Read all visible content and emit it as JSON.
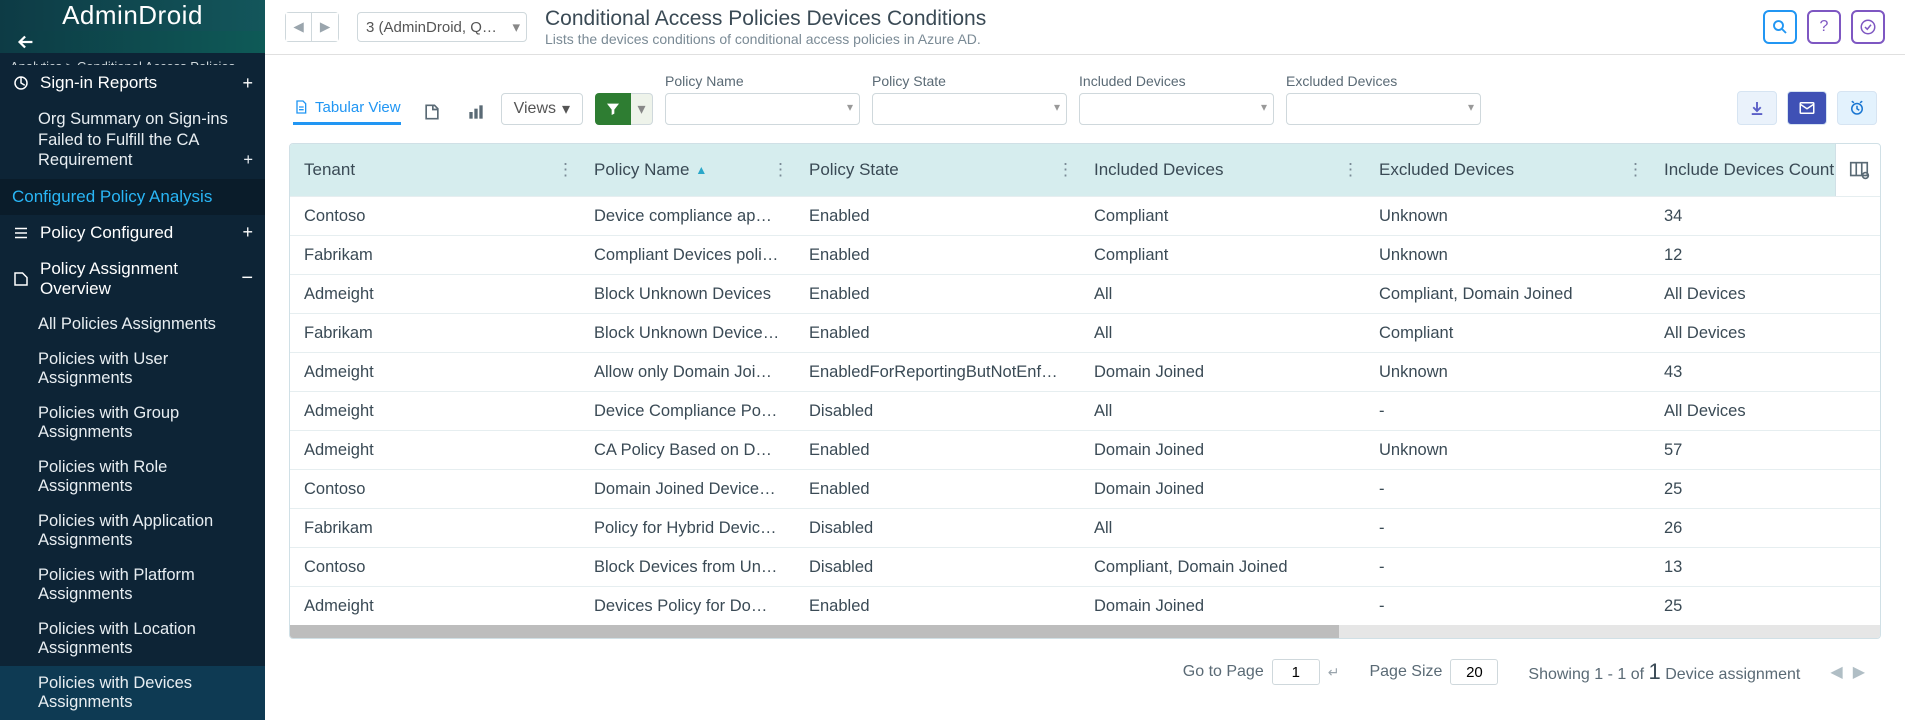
{
  "brand": "AdminDroid",
  "breadcrumb": "Analytics > Conditional Access Policies Ana…",
  "sidebar": {
    "signin": "Sign-in Reports",
    "org_summary": "Org Summary on Sign-ins Failed to Fulfill the CA Requirement",
    "config_analysis": "Configured Policy Analysis",
    "policy_configured": "Policy Configured",
    "assignment_overview": "Policy Assignment Overview",
    "subs": [
      "All Policies Assignments",
      "Policies with User Assignments",
      "Policies with Group Assignments",
      "Policies with Role Assignments",
      "Policies with Application Assignments",
      "Policies with Platform Assignments",
      "Policies with Location Assignments",
      "Policies with Devices Assignments"
    ]
  },
  "header": {
    "tenant_dd": "3 (AdminDroid, Q…",
    "title": "Conditional Access Policies Devices Conditions",
    "subtitle": "Lists the devices conditions of conditional access policies in Azure AD."
  },
  "toolbar": {
    "tabular": "Tabular View",
    "views": "Views",
    "filters": {
      "policy_name": "Policy Name",
      "policy_state": "Policy State",
      "included": "Included Devices",
      "excluded": "Excluded Devices"
    }
  },
  "columns": [
    "Tenant",
    "Policy Name",
    "Policy State",
    "Included Devices",
    "Excluded Devices",
    "Include Devices Count"
  ],
  "rows": [
    {
      "c": [
        "Contoso",
        "Device compliance app…",
        "Enabled",
        "Compliant",
        "Unknown",
        "34"
      ]
    },
    {
      "c": [
        "Fabrikam",
        "Compliant Devices poli…",
        "Enabled",
        "Compliant",
        "Unknown",
        "12"
      ]
    },
    {
      "c": [
        "Admeight",
        "Block Unknown Devices",
        "Enabled",
        "All",
        "Compliant, Domain Joined",
        "All Devices"
      ]
    },
    {
      "c": [
        "Fabrikam",
        "Block Unknown Device…",
        "Enabled",
        "All",
        "Compliant",
        "All Devices"
      ]
    },
    {
      "c": [
        "Admeight",
        "Allow only Domain Joi…",
        "EnabledForReportingButNotEnfor…",
        "Domain Joined",
        "Unknown",
        "43"
      ]
    },
    {
      "c": [
        "Admeight",
        "Device Compliance Pol…",
        "Disabled",
        "All",
        "-",
        "All Devices"
      ]
    },
    {
      "c": [
        "Admeight",
        "CA Policy Based on Do…",
        "Enabled",
        "Domain Joined",
        "Unknown",
        "57"
      ]
    },
    {
      "c": [
        "Contoso",
        "Domain Joined Device…",
        "Enabled",
        "Domain Joined",
        "-",
        "25"
      ]
    },
    {
      "c": [
        "Fabrikam",
        "Policy for Hybrid Devic…",
        "Disabled",
        "All",
        "-",
        "26"
      ]
    },
    {
      "c": [
        "Contoso",
        "Block Devices from Unf…",
        "Disabled",
        "Compliant, Domain Joined",
        "-",
        "13"
      ]
    },
    {
      "c": [
        "Admeight",
        "Devices Policy for Dom…",
        "Enabled",
        "Domain Joined",
        "-",
        "25"
      ]
    }
  ],
  "footer": {
    "goto_label": "Go to Page",
    "goto_value": "1",
    "size_label": "Page Size",
    "size_value": "20",
    "showing_prefix": "Showing",
    "range": "1 - 1",
    "of": "of",
    "total": "1",
    "suffix": "Device assignment"
  }
}
